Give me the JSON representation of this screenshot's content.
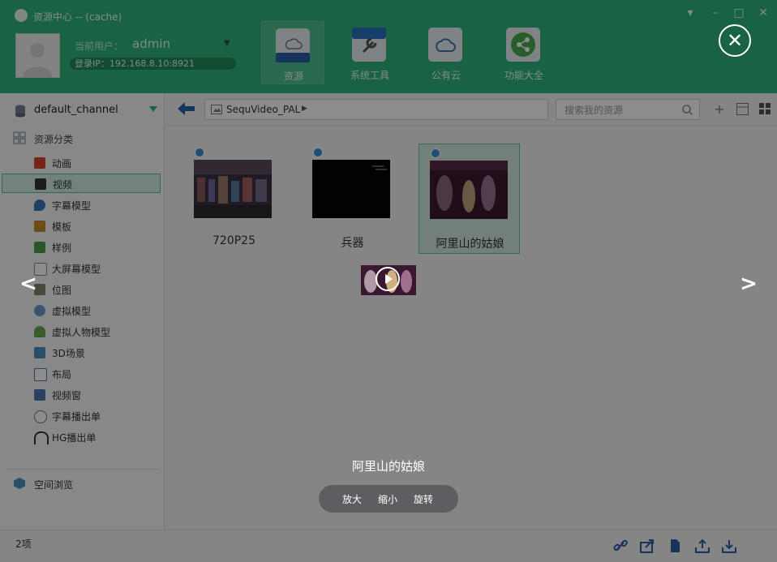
{
  "window": {
    "title": "资源中心 -- (cache)"
  },
  "user": {
    "label": "当前用户：",
    "name": "admin",
    "ip": "登录IP：192.168.8.10:8921"
  },
  "tools": [
    {
      "label": "资源",
      "icon": "cloud-box-icon"
    },
    {
      "label": "系统工具",
      "icon": "wrench-icon"
    },
    {
      "label": "公有云",
      "icon": "cloud-icon"
    },
    {
      "label": "功能大全",
      "icon": "nodes-icon"
    }
  ],
  "sidebar": {
    "channel": "default_channel",
    "section_title": "资源分类",
    "items": [
      {
        "label": "动画",
        "icon": "animation-icon",
        "color": "#d9432f"
      },
      {
        "label": "视频",
        "icon": "clapper-icon",
        "color": "#333333"
      },
      {
        "label": "字幕模型",
        "icon": "droplet-icon",
        "color": "#3b77b5"
      },
      {
        "label": "模板",
        "icon": "template-icon",
        "color": "#c88a2a"
      },
      {
        "label": "样例",
        "icon": "puzzle-icon",
        "color": "#4aa04a"
      },
      {
        "label": "大屏幕模型",
        "icon": "monitor-icon",
        "color": "#8a8a8a"
      },
      {
        "label": "位图",
        "icon": "bitmap-icon",
        "color": "#7a8a6a"
      },
      {
        "label": "虚拟模型",
        "icon": "teapot-icon",
        "color": "#6b9bd1"
      },
      {
        "label": "虚拟人物模型",
        "icon": "person-icon",
        "color": "#6aa84f"
      },
      {
        "label": "3D场景",
        "icon": "cube-icon",
        "color": "#4a90c2"
      },
      {
        "label": "布局",
        "icon": "layout-icon",
        "color": "#4a78b0"
      },
      {
        "label": "视频窗",
        "icon": "video-window-icon",
        "color": "#4a78b0"
      },
      {
        "label": "字幕播出单",
        "icon": "clock-list-icon",
        "color": "#777777"
      },
      {
        "label": "HG播出单",
        "icon": "headphones-icon",
        "color": "#333333"
      }
    ],
    "space_browse": "空间浏览"
  },
  "toolbar": {
    "path": "SequVideo_PAL",
    "search_placeholder": "搜索我的资源"
  },
  "items": [
    {
      "name": "720P25"
    },
    {
      "name": "兵器"
    },
    {
      "name": "阿里山的姑娘"
    }
  ],
  "status": {
    "count": "2项"
  },
  "preview": {
    "title": "阿里山的姑娘",
    "prev": "<",
    "next": ">",
    "zoom_in": "放大",
    "zoom_out": "缩小",
    "rotate": "旋转"
  },
  "colors": {
    "accent": "#2fb47c",
    "selected_bg": "#d1efe0"
  }
}
